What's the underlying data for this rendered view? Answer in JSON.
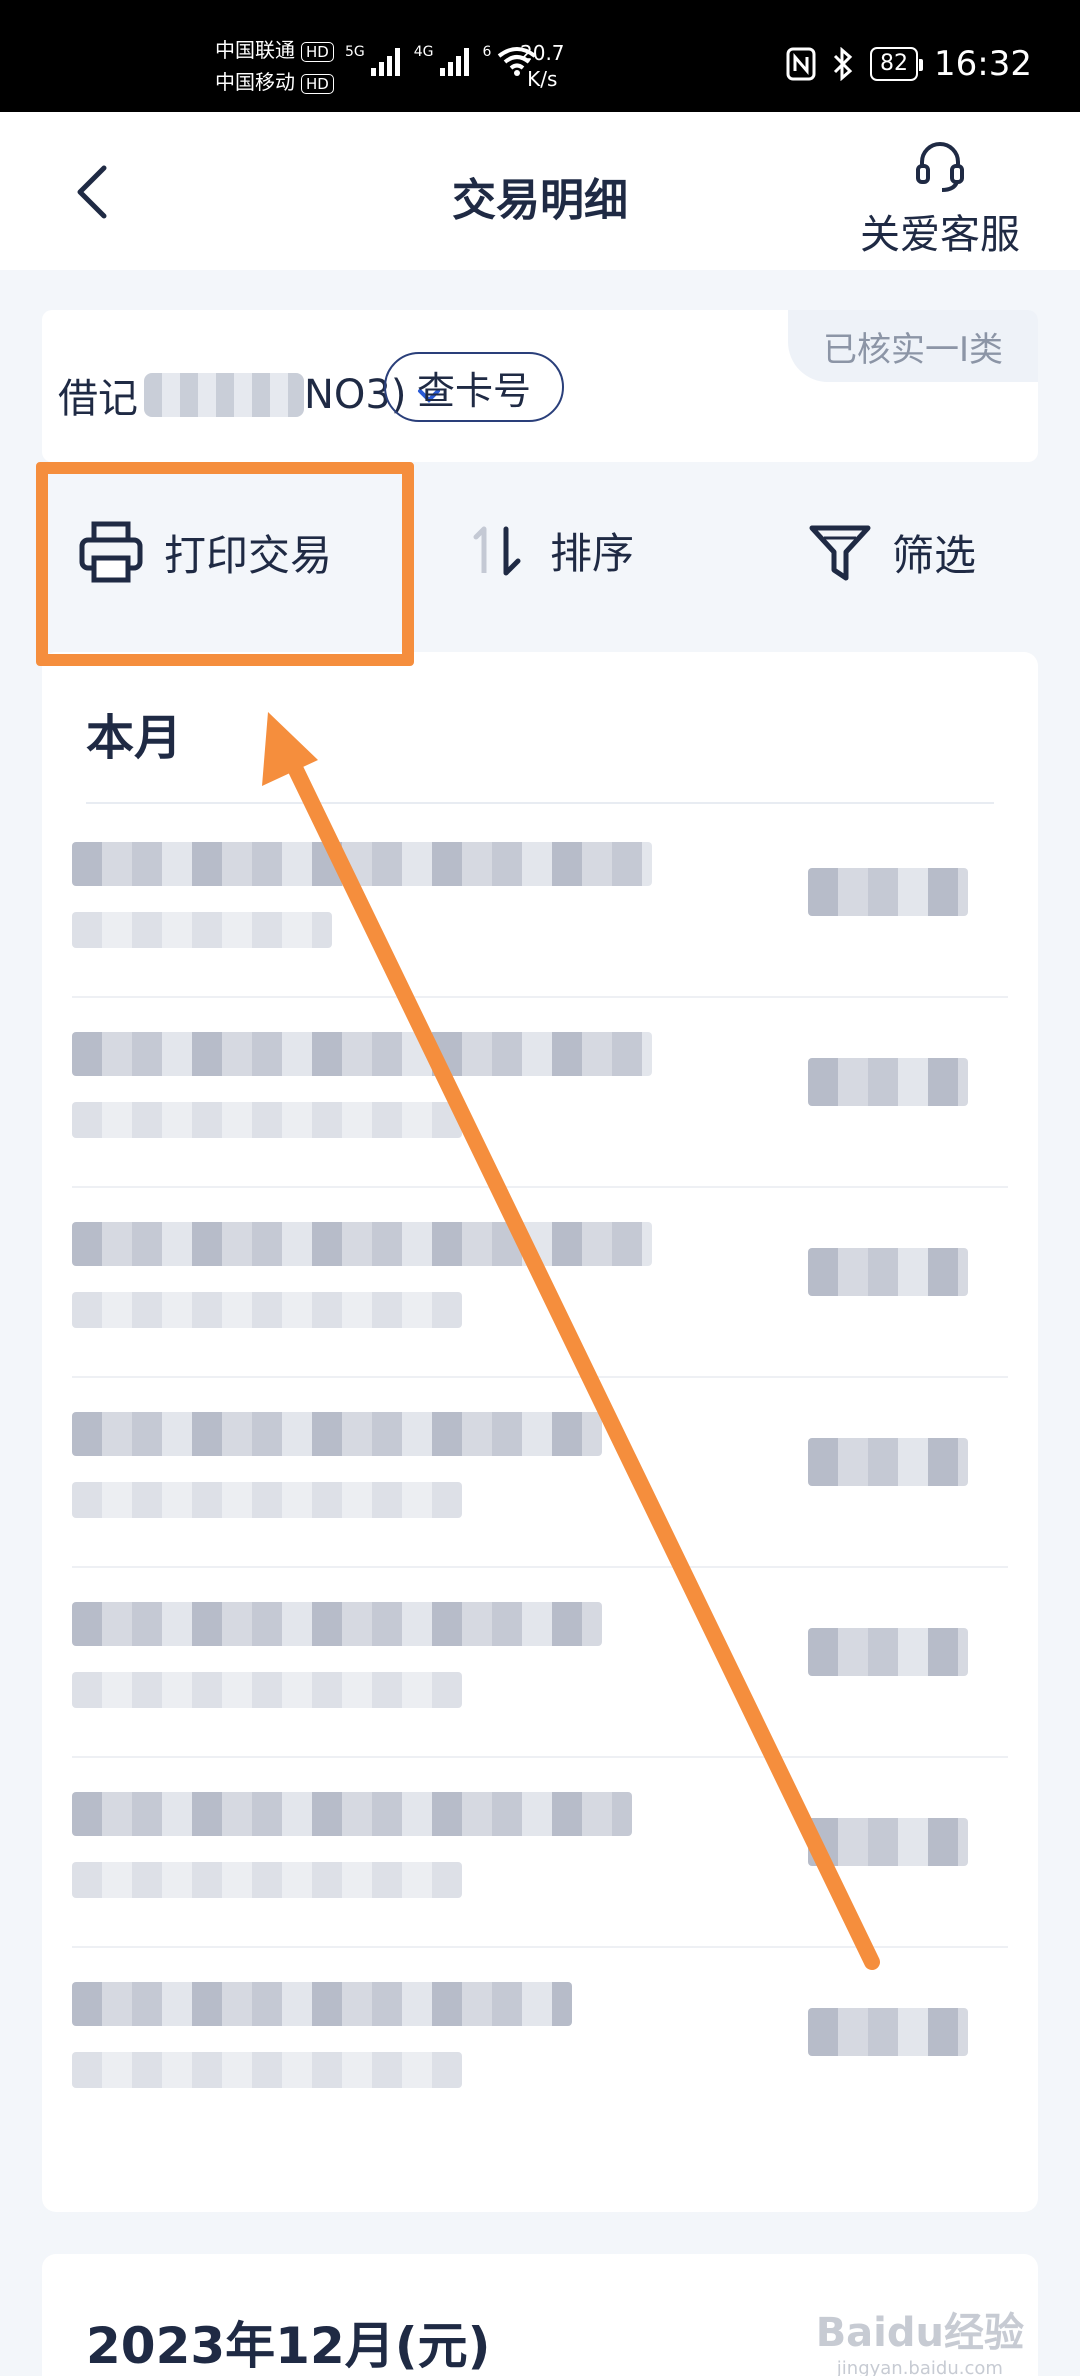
{
  "status_bar": {
    "carrier_1": "中国联通",
    "carrier_2": "中国移动",
    "hd": "HD",
    "net_5g": "5G",
    "net_4g": "4G",
    "wifi_num": "6",
    "speed_value": "20.7",
    "speed_unit": "K/s",
    "battery": "82",
    "time": "16:32"
  },
  "header": {
    "title": "交易明细",
    "customer_service": "关爱客服"
  },
  "account": {
    "type": "借记",
    "suffix_hint": "NO3)",
    "card_no_button": "查卡号",
    "verified_badge": "已核实一I类"
  },
  "toolbar": {
    "print": "打印交易",
    "sort": "排序",
    "filter": "筛选"
  },
  "list": {
    "section_title": "本月",
    "rows": [
      {
        "id": "r1"
      },
      {
        "id": "r2"
      },
      {
        "id": "r3"
      },
      {
        "id": "r4"
      },
      {
        "id": "r5"
      },
      {
        "id": "r6"
      },
      {
        "id": "r7"
      }
    ]
  },
  "next_month": {
    "title": "2023年12月(元)"
  },
  "watermark": {
    "main": "Baidu经验",
    "sub": "jingyan.baidu.com"
  },
  "colors": {
    "accent_orange": "#f58e3d",
    "navy_text": "#1f2a44",
    "page_bg": "#f3f6fa"
  }
}
